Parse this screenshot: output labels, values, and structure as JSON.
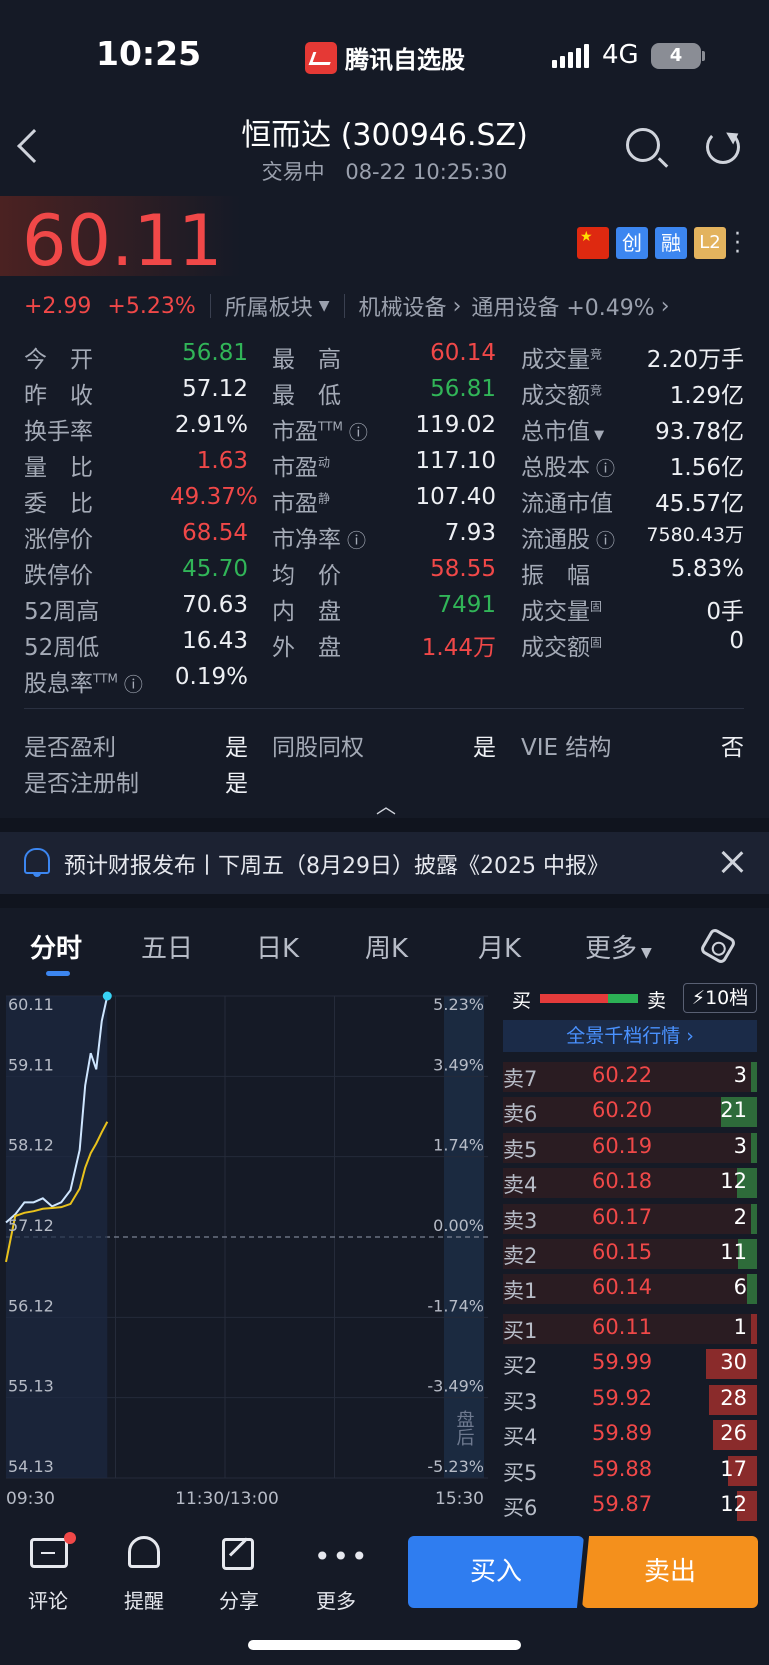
{
  "status_bar": {
    "time": "10:25",
    "app_name": "腾讯自选股",
    "network": "4G",
    "battery": "4"
  },
  "header": {
    "title": "恒而达 (300946.SZ)",
    "status": "交易中",
    "datetime": "08-22 10:25:30"
  },
  "quote": {
    "price": "60.11",
    "change": "+2.99",
    "change_pct": "+5.23%",
    "sector_label": "所属板块",
    "sector_1": "机械设备",
    "sector_2": "通用设备 +0.49%",
    "badges": {
      "chuang": "创",
      "rong": "融",
      "l2": "L2"
    }
  },
  "stats": {
    "col1": [
      {
        "label": "今　开",
        "value": "56.81"
      },
      {
        "label": "昨　收",
        "value": "57.12"
      },
      {
        "label": "换手率",
        "value": "2.91%"
      },
      {
        "label": "量　比",
        "value": "1.63"
      },
      {
        "label": "委　比",
        "value": "49.37%"
      },
      {
        "label": "涨停价",
        "value": "68.54"
      },
      {
        "label": "跌停价",
        "value": "45.70"
      },
      {
        "label": "52周高",
        "value": "70.63"
      },
      {
        "label": "52周低",
        "value": "16.43"
      },
      {
        "label": "股息率TTM",
        "value": "0.19%"
      }
    ],
    "col2": [
      {
        "label": "最　高",
        "value": "60.14"
      },
      {
        "label": "最　低",
        "value": "56.81"
      },
      {
        "label": "市盈TTM",
        "value": "119.02"
      },
      {
        "label": "市盈动",
        "value": "117.10"
      },
      {
        "label": "市盈静",
        "value": "107.40"
      },
      {
        "label": "市净率",
        "value": "7.93"
      },
      {
        "label": "均　价",
        "value": "58.55"
      },
      {
        "label": "内　盘",
        "value": "7491"
      },
      {
        "label": "外　盘",
        "value": "1.44万"
      }
    ],
    "col3": [
      {
        "label": "成交量竞",
        "value": "2.20万手"
      },
      {
        "label": "成交额竞",
        "value": "1.29亿"
      },
      {
        "label": "总市值",
        "value": "93.78亿"
      },
      {
        "label": "总股本",
        "value": "1.56亿"
      },
      {
        "label": "流通市值",
        "value": "45.57亿"
      },
      {
        "label": "流通股",
        "value": "7580.43万"
      },
      {
        "label": "振　幅",
        "value": "5.83%"
      },
      {
        "label": "成交量固",
        "value": "0手"
      },
      {
        "label": "成交额固",
        "value": "0"
      }
    ]
  },
  "flags": [
    {
      "label": "是否盈利",
      "value": "是"
    },
    {
      "label": "同股同权",
      "value": "是"
    },
    {
      "label": "VIE 结构",
      "value": "否"
    },
    {
      "label": "是否注册制",
      "value": "是"
    }
  ],
  "notice": {
    "text": "预计财报发布丨下周五（8月29日）披露《2025 中报》"
  },
  "tabs": [
    "分时",
    "五日",
    "日K",
    "周K",
    "月K",
    "更多"
  ],
  "chart": {
    "y_left": [
      "60.11",
      "59.11",
      "58.12",
      "57.12",
      "56.12",
      "55.13",
      "54.13"
    ],
    "y_right": [
      "5.23%",
      "3.49%",
      "1.74%",
      "0.00%",
      "-1.74%",
      "-3.49%",
      "-5.23%"
    ],
    "x_labels": [
      "09:30",
      "11:30/13:00",
      "15:30"
    ],
    "after_hours": "盘后"
  },
  "chart_data": {
    "type": "line",
    "x": [
      "09:30",
      "09:35",
      "09:40",
      "09:45",
      "09:50",
      "09:55",
      "10:00",
      "10:05",
      "10:10",
      "10:13",
      "10:16",
      "10:19",
      "10:22",
      "10:25"
    ],
    "series": [
      {
        "values": [
          57.3,
          57.4,
          57.55,
          57.55,
          57.6,
          57.5,
          57.55,
          57.7,
          58.2,
          59.0,
          59.4,
          59.2,
          59.8,
          60.11
        ]
      },
      {
        "values": [
          56.81,
          57.38,
          57.42,
          57.44,
          57.47,
          57.48,
          57.49,
          57.53,
          57.72,
          57.98,
          58.16,
          58.28,
          58.42,
          58.55
        ]
      }
    ],
    "ylim": [
      54.13,
      60.11
    ],
    "reference": 57.12
  },
  "order_book": {
    "buy_label": "买",
    "sell_label": "卖",
    "levels_btn": "10档",
    "full_depth": "全景千档行情",
    "asks": [
      {
        "label": "卖7",
        "price": "60.22",
        "vol": "3"
      },
      {
        "label": "卖6",
        "price": "60.20",
        "vol": "21"
      },
      {
        "label": "卖5",
        "price": "60.19",
        "vol": "3"
      },
      {
        "label": "卖4",
        "price": "60.18",
        "vol": "12"
      },
      {
        "label": "卖3",
        "price": "60.17",
        "vol": "2"
      },
      {
        "label": "卖2",
        "price": "60.15",
        "vol": "11"
      },
      {
        "label": "卖1",
        "price": "60.14",
        "vol": "6"
      }
    ],
    "bids": [
      {
        "label": "买1",
        "price": "60.11",
        "vol": "1"
      },
      {
        "label": "买2",
        "price": "59.99",
        "vol": "30"
      },
      {
        "label": "买3",
        "price": "59.92",
        "vol": "28"
      },
      {
        "label": "买4",
        "price": "59.89",
        "vol": "26"
      },
      {
        "label": "买5",
        "price": "59.88",
        "vol": "17"
      },
      {
        "label": "买6",
        "price": "59.87",
        "vol": "12"
      }
    ]
  },
  "bottom_nav": {
    "comment": "评论",
    "alert": "提醒",
    "share": "分享",
    "more": "更多",
    "buy": "买入",
    "sell": "卖出"
  }
}
